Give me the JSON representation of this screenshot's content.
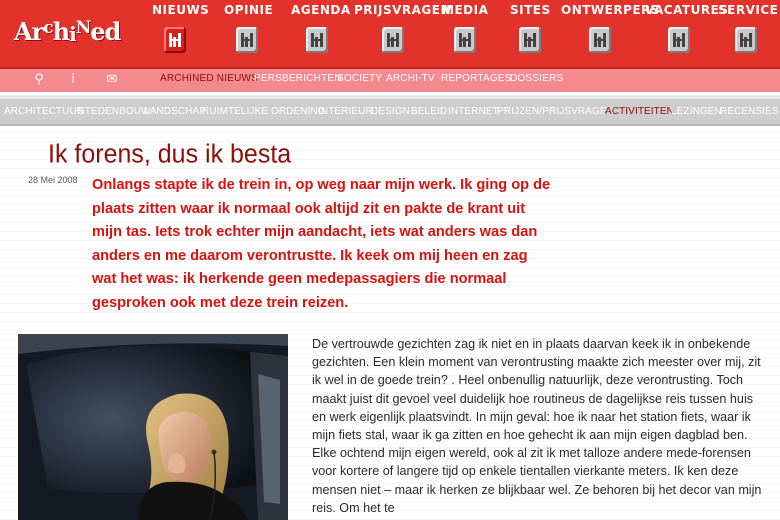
{
  "site": {
    "logo_text": "ArchiNed"
  },
  "main_nav": [
    {
      "label": "NIEUWS",
      "active": true
    },
    {
      "label": "OPINIE"
    },
    {
      "label": "AGENDA"
    },
    {
      "label": "PRIJSVRAGEN"
    },
    {
      "label": "MEDIA"
    },
    {
      "label": "SITES"
    },
    {
      "label": "ONTWERPERS"
    },
    {
      "label": "VACATURES"
    },
    {
      "label": "SERVICE"
    }
  ],
  "tools": [
    {
      "icon": "search-icon",
      "glyph": "⚲"
    },
    {
      "icon": "info-icon",
      "glyph": "i"
    },
    {
      "icon": "mail-icon",
      "glyph": "✉"
    }
  ],
  "sub_nav": [
    {
      "label": "ARCHINED NIEUWS",
      "active": true
    },
    {
      "label": "PERSBERICHTEN"
    },
    {
      "label": "SOCIETY"
    },
    {
      "label": "ARCHI-TV"
    },
    {
      "label": "REPORTAGES"
    },
    {
      "label": "DOSSIERS"
    }
  ],
  "categories": [
    {
      "label": "ARCHITECTUUR"
    },
    {
      "label": "STEDENBOUW"
    },
    {
      "label": "LANDSCHAP"
    },
    {
      "label": "RUIMTELIJKE ORDENING"
    },
    {
      "label": "INTERIEUR"
    },
    {
      "label": "DESIGN"
    },
    {
      "label": "BELEID"
    },
    {
      "label": "INTERNET"
    },
    {
      "label": "PRIJZEN/PRIJSVRAGEN"
    },
    {
      "label": "ACTIVITEITEN",
      "active": true
    },
    {
      "label": "LEZINGEN"
    },
    {
      "label": "RECENSIES"
    }
  ],
  "article": {
    "title": "Ik forens, dus ik besta",
    "date": "28 Mei 2008",
    "lead": "Onlangs stapte ik de trein in, op weg naar mijn werk. Ik ging op de plaats zitten waar ik normaal ook altijd zit en pakte de krant uit mijn tas. Iets trok echter mijn aandacht, iets wat anders was dan anders en me daarom verontrustte. Ik keek om mij heen en zag wat het was: ik herkende geen medepassagiers die normaal gesproken ook met deze trein reizen.",
    "body": "De vertrouwde gezichten zag ik niet en in plaats daarvan keek ik in onbekende gezichten. Een klein moment van verontrusting maakte zich meester over mij, zit ik wel in de goede trein? . Heel onbenullig natuurlijk, deze verontrusting. Toch maakt juist dit gevoel veel duidelijk hoe routineus de dagelijkse reis tussen huis en werk eigenlijk plaatsvindt. In mijn geval: hoe ik naar het station fiets, waar ik mijn fiets stal, waar ik ga zitten en hoe gehecht ik aan mijn eigen dagblad ben. Elke ochtend mijn eigen wereld, ook al zit ik met talloze andere mede-forensen voor kortere of langere tijd op enkele tientallen vierkante meters. Ik ken deze mensen niet – maar ik herken ze blijkbaar wel. Ze behoren bij het decor van mijn reis. Om het te"
  },
  "colors": {
    "brand_red": "#e3312b",
    "subnav_pink": "#f48a8e",
    "title_dark_red": "#8e0e0b",
    "lead_red": "#d8120f",
    "category_grey": "#cdcdcd"
  }
}
